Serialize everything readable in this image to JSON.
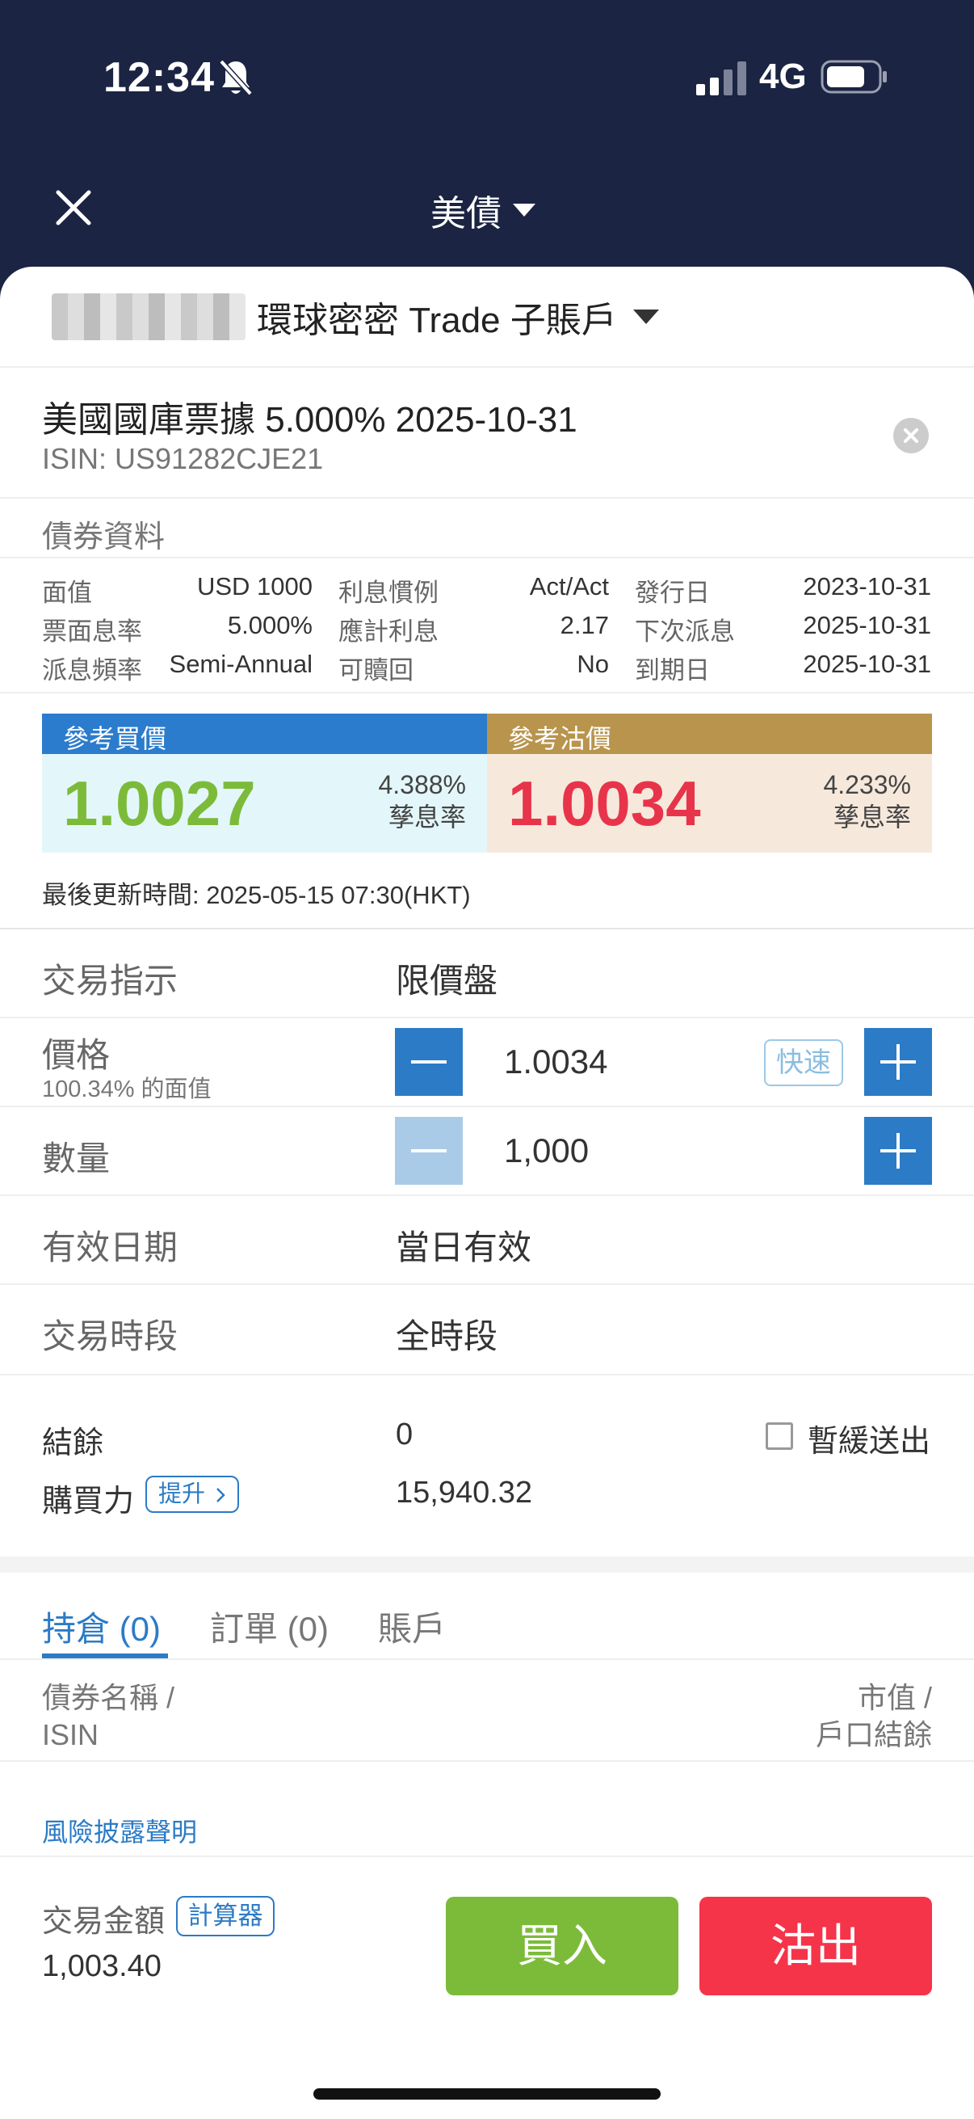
{
  "status_bar": {
    "time": "12:34",
    "network": "4G"
  },
  "header": {
    "title": "美債"
  },
  "account": {
    "name": "環球密密 Trade 子賬戶"
  },
  "bond": {
    "name": "美國國庫票據 5.000% 2025-10-31",
    "isin": "ISIN: US91282CJE21"
  },
  "bond_info": {
    "section_title": "債券資料",
    "rows": [
      [
        {
          "label": "面值",
          "value": "USD 1000"
        },
        {
          "label": "利息慣例",
          "value": "Act/Act"
        },
        {
          "label": "發行日",
          "value": "2023-10-31"
        }
      ],
      [
        {
          "label": "票面息率",
          "value": "5.000%"
        },
        {
          "label": "應計利息",
          "value": "2.17"
        },
        {
          "label": "下次派息",
          "value": "2025-10-31"
        }
      ],
      [
        {
          "label": "派息頻率",
          "value": "Semi-Annual"
        },
        {
          "label": "可贖回",
          "value": "No"
        },
        {
          "label": "到期日",
          "value": "2025-10-31"
        }
      ]
    ]
  },
  "quotes": {
    "buy": {
      "title": "參考買價",
      "price": "1.0027",
      "yield": "4.388%",
      "yield_label": "孳息率"
    },
    "sell": {
      "title": "參考沽價",
      "price": "1.0034",
      "yield": "4.233%",
      "yield_label": "孳息率"
    },
    "update_time": "最後更新時間: 2025-05-15 07:30(HKT)"
  },
  "order_form": {
    "instruction": {
      "label": "交易指示",
      "value": "限價盤"
    },
    "price": {
      "label": "價格",
      "sub_label": "100.34% 的面值",
      "value": "1.0034",
      "quick_label": "快速"
    },
    "quantity": {
      "label": "數量",
      "value": "1,000"
    },
    "validity": {
      "label": "有效日期",
      "value": "當日有效"
    },
    "session": {
      "label": "交易時段",
      "value": "全時段"
    }
  },
  "balance": {
    "label": "結餘",
    "value": "0",
    "hold_label": "暫緩送出"
  },
  "buying_power": {
    "label": "購買力",
    "upgrade_label": "提升",
    "value": "15,940.32"
  },
  "tabs": [
    {
      "label": "持倉 (0)"
    },
    {
      "label": "訂單 (0)"
    },
    {
      "label": "賬戶"
    }
  ],
  "positions_table": {
    "col_left_1": "債券名稱 /",
    "col_left_2": "ISIN",
    "col_right_1": "市值 /",
    "col_right_2": "戶口結餘"
  },
  "risk_disclosure": "風險披露聲明",
  "footer": {
    "amount_label": "交易金額",
    "calculator_label": "計算器",
    "amount_value": "1,003.40",
    "buy_label": "買入",
    "sell_label": "沽出"
  },
  "colors": {
    "navy": "#1b2442",
    "accent_blue": "#2c7bc6",
    "buy_green": "#7cbb3a",
    "sell_red": "#f53449",
    "sell_header_gold": "#b8944d"
  }
}
